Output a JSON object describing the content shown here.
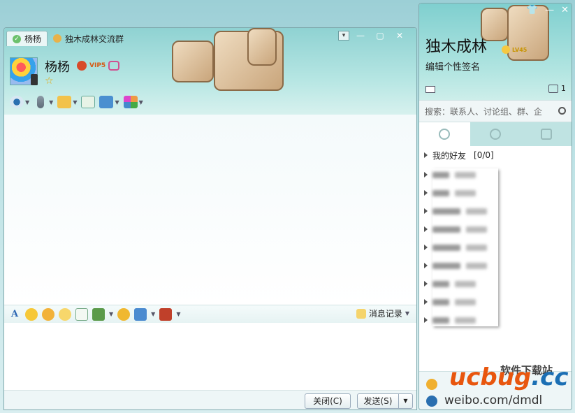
{
  "chat_window": {
    "tabs": [
      {
        "label": "杨杨",
        "active": true
      },
      {
        "label": "独木成林交流群",
        "active": false
      }
    ],
    "contact_name": "杨杨",
    "vip_label": "VIP5",
    "history_label": "消息记录",
    "close_button": "关闭(C)",
    "send_button": "发送(S)"
  },
  "sidebar": {
    "user_name": "独木成林",
    "level": "LV45",
    "signature": "编辑个性签名",
    "message_count": "1",
    "search_placeholder": "搜索：联系人、讨论组、群、企",
    "groups": [
      {
        "label": "我的好友",
        "count": "[0/0]"
      }
    ]
  },
  "watermark": {
    "top": "软件下载站",
    "brand_a": "ucbug",
    "brand_b": ".cc",
    "bottom": "weibo.com/dmdl"
  },
  "colors": {
    "header_teal": "#9dd8d5",
    "frame": "#7fa9ad",
    "brand_orange": "#e8560e",
    "brand_blue": "#1b6fb4"
  }
}
